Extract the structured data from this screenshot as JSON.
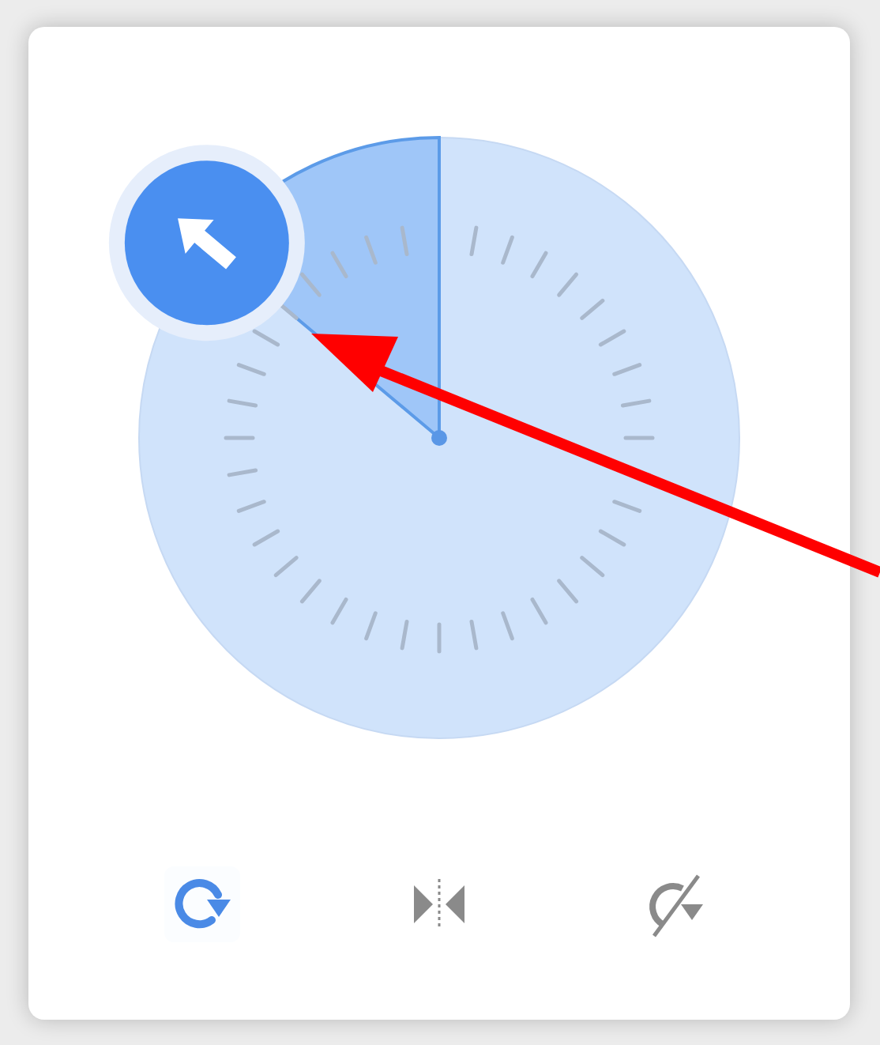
{
  "tools": [
    {
      "kind": "rotate",
      "selected": true
    },
    {
      "kind": "mirror",
      "selected": false
    },
    {
      "kind": "reset",
      "selected": false
    }
  ]
}
